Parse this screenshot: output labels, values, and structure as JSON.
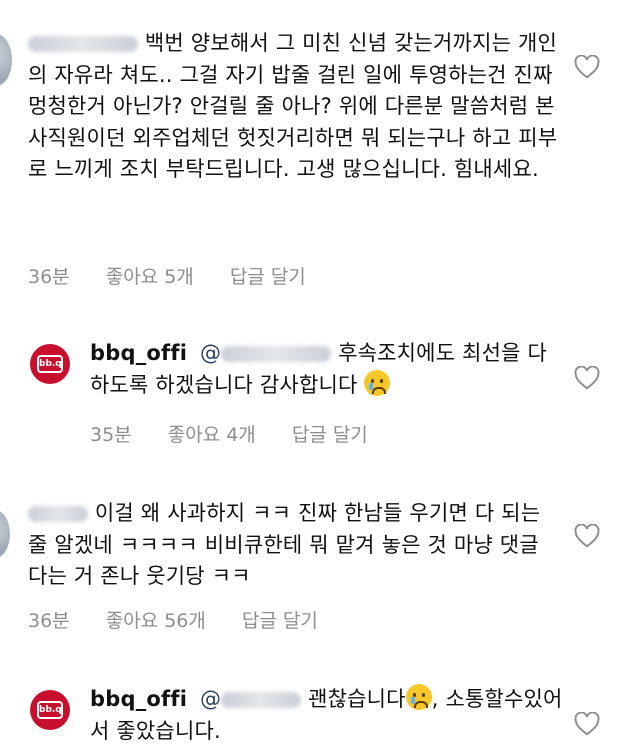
{
  "comments": [
    {
      "text_line1": "백번 양보해서 그 미친 신념 갖는거까",
      "text_rest": "지는 개인의 자유라 쳐도.. 그걸 자기 밥줄 걸린 일에 투영하는건 진짜 멍청한거 아닌가? 안걸릴 줄 아나? 위에 다른분 말씀처럼 본사직원이던 외주업체던 헛짓거리하면 뭐 되는구나 하고 피부로 느끼게 조치 부탁드립니다. 고생 많으십니다. 힘내세요.",
      "time": "36분",
      "likes": "좋아요 5개",
      "reply": "답글 달기"
    },
    {
      "username": "bbq_offi",
      "mention": "@",
      "text": "후속조치에도 최선을 다하도록 하겠습니다 감사합니다",
      "time": "35분",
      "likes": "좋아요 4개",
      "reply": "답글 달기",
      "logo": "bb.q"
    },
    {
      "text": "이걸 왜 사과하지 ㅋㅋ 진짜 한남들 우기면 다 되는 줄 알겠네 ㅋㅋㅋㅋ 비비큐한테 뭐 맡겨 놓은 것 마냥 댓글 다는 거 존나 웃기당 ㅋㅋ",
      "time": "36분",
      "likes": "좋아요 56개",
      "reply": "답글 달기"
    },
    {
      "username": "bbq_offi",
      "mention": "@",
      "text_a": "괜찮습니다",
      "text_b": ", 소통할수있어서 좋았습니다.",
      "logo": "bb.q"
    }
  ],
  "icons": {
    "like": "heart-outline-icon",
    "emoji": "crying-face-icon"
  }
}
